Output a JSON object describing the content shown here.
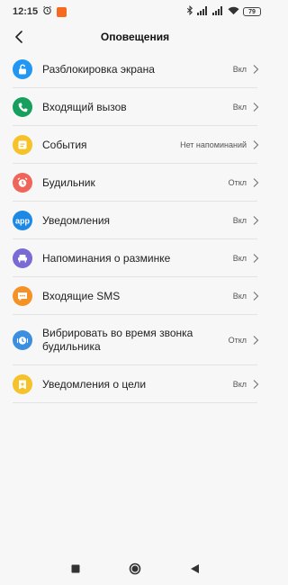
{
  "status_bar": {
    "time": "12:15",
    "battery": "79",
    "icons": [
      "alarm-icon",
      "notification-badge-icon",
      "bluetooth-icon",
      "signal-icon",
      "signal-icon",
      "wifi-icon",
      "battery-icon"
    ]
  },
  "header": {
    "title": "Оповещения",
    "back_icon": "back-arrow-icon"
  },
  "list": {
    "items": [
      {
        "label": "Разблокировка экрана",
        "value": "Вкл",
        "icon": "unlock-icon",
        "color": "#2196f3"
      },
      {
        "label": "Входящий вызов",
        "value": "Вкл",
        "icon": "phone-icon",
        "color": "#17a05d"
      },
      {
        "label": "События",
        "value": "Нет напоминаний",
        "icon": "calendar-icon",
        "color": "#f6c22a"
      },
      {
        "label": "Будильник",
        "value": "Откл",
        "icon": "alarm-clock-icon",
        "color": "#f0655a"
      },
      {
        "label": "Уведомления",
        "value": "Вкл",
        "icon": "app-icon",
        "color": "#1e88e5"
      },
      {
        "label": "Напоминания о разминке",
        "value": "Вкл",
        "icon": "chair-icon",
        "color": "#7a6ad6"
      },
      {
        "label": "Входящие SMS",
        "value": "Вкл",
        "icon": "sms-icon",
        "color": "#f59226"
      },
      {
        "label": "Вибрировать во время звонка будильника",
        "value": "Откл",
        "icon": "alarm-vibrate-icon",
        "color": "#3b8fe0"
      },
      {
        "label": "Уведомления о цели",
        "value": "Вкл",
        "icon": "goal-icon",
        "color": "#f6c22a"
      }
    ]
  },
  "nav_bar": {
    "buttons": [
      "recents-icon",
      "home-icon",
      "back-icon"
    ]
  }
}
